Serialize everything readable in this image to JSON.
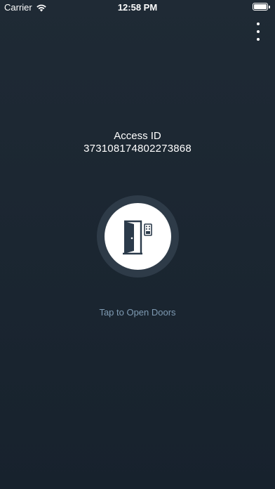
{
  "status_bar": {
    "carrier": "Carrier",
    "time": "12:58 PM"
  },
  "menu": {
    "icon": "more-vertical-icon"
  },
  "access": {
    "label": "Access ID",
    "id_value": "373108174802273868"
  },
  "door_button": {
    "icon": "door-keypad-icon",
    "caption": "Tap to Open Doors"
  },
  "colors": {
    "background": "#1c2732",
    "ring": "#2e3b48",
    "button": "#ffffff",
    "icon": "#2b3a4a",
    "caption": "#7f9bb3"
  }
}
